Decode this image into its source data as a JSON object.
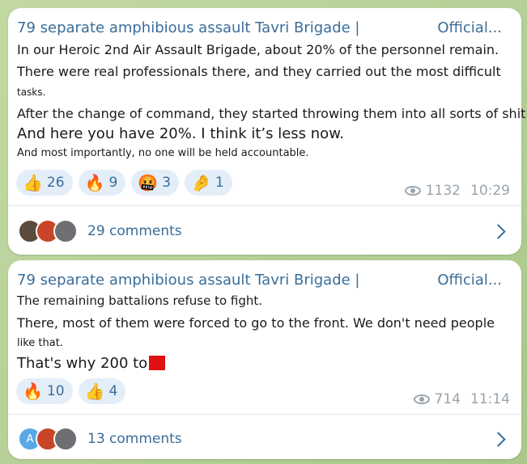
{
  "posts": [
    {
      "channel": "79 separate amphibious assault Tavri Brigade |",
      "badge": "Official...",
      "lines": [
        "In our Heroic 2nd Air Assault Brigade, about 20% of the personnel remain.",
        "There were real professionals there, and they carried out the most difficult",
        "tasks.",
        "After the change of command, they started throwing them into all sorts of shit.",
        "And here you have 20%. I think it’s less now.",
        "And most importantly, no one will be held accountable."
      ],
      "reactions": [
        {
          "emoji": "👍",
          "count": "26"
        },
        {
          "emoji": "🔥",
          "count": "9"
        },
        {
          "emoji": "🤬",
          "count": "3"
        },
        {
          "emoji": "🤌",
          "count": "1"
        }
      ],
      "views": "1132",
      "time": "10:29",
      "comments": "29 comments",
      "avatar_colors": [
        "#5b4a3e",
        "#c8452a",
        "#6d6f72"
      ]
    },
    {
      "channel": "79 separate amphibious assault Tavri Brigade |",
      "badge": "Official...",
      "lines": [
        "The remaining battalions refuse to fight.",
        "There, most of them were forced to go to the front. We don't need people",
        "like that.",
        "That's why 200 to"
      ],
      "reactions": [
        {
          "emoji": "🔥",
          "count": "10"
        },
        {
          "emoji": "👍",
          "count": "4"
        }
      ],
      "views": "714",
      "time": "11:14",
      "comments": "13 comments",
      "avatar_letter": "A",
      "avatar_colors": [
        "#5aa7e6",
        "#c8452a",
        "#6d6f72"
      ]
    }
  ],
  "colors": {
    "accent": "#3a6d99",
    "pill_bg": "#e4eef8",
    "meta": "#9aa3ab"
  }
}
